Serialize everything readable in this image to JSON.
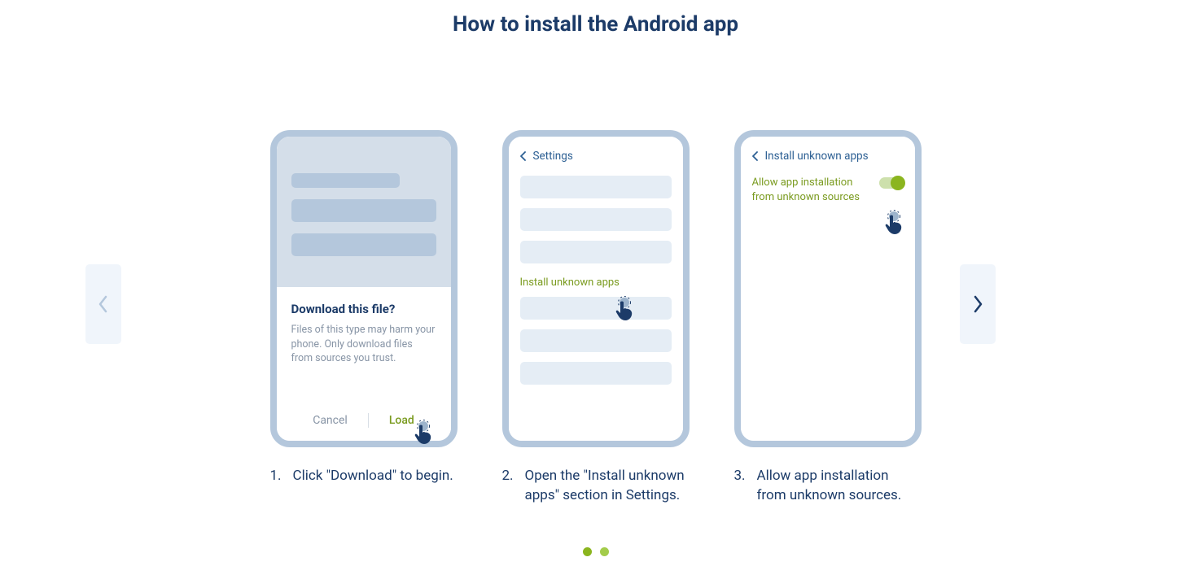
{
  "title": "How to install the Android app",
  "steps": [
    {
      "num": "1.",
      "caption": "Click \"Download\" to begin.",
      "phone": {
        "dialog_title": "Download this file?",
        "dialog_desc": "Files of this type may harm your phone. Only download files from sources you trust.",
        "cancel": "Cancel",
        "load": "Load"
      }
    },
    {
      "num": "2.",
      "caption": "Open the \"Install unknown apps\" section in Settings.",
      "phone": {
        "header": "Settings",
        "highlight": "Install unknown apps"
      }
    },
    {
      "num": "3.",
      "caption": "Allow app installation from unknown sources.",
      "phone": {
        "header": "Install unknown apps",
        "allow_text": "Allow app installation from unknown sources"
      }
    }
  ]
}
